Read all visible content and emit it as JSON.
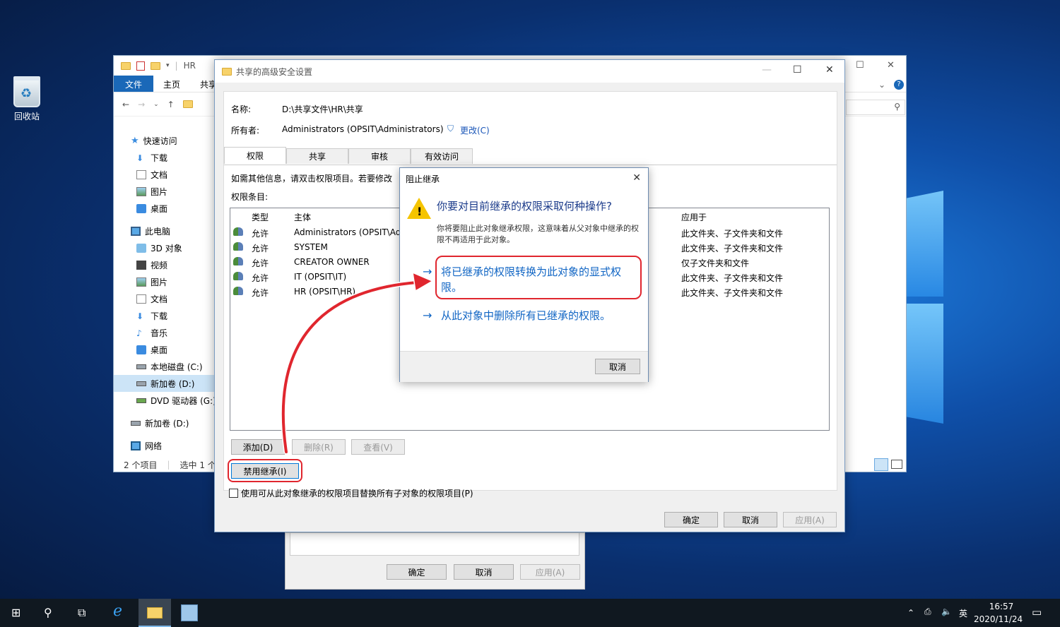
{
  "desktop": {
    "recycle_bin_label": "回收站"
  },
  "explorer": {
    "title": "HR",
    "ribbon_tabs": [
      "文件",
      "主页",
      "共享"
    ],
    "nav": {
      "quick_access": "快速访问",
      "downloads": "下载",
      "documents": "文档",
      "pictures": "图片",
      "desktop": "桌面",
      "this_pc": "此电脑",
      "objects_3d": "3D 对象",
      "videos": "视频",
      "pictures2": "图片",
      "documents2": "文档",
      "downloads2": "下载",
      "music": "音乐",
      "desktop2": "桌面",
      "local_disk": "本地磁盘 (C:)",
      "new_volume": "新加卷 (D:)",
      "dvd": "DVD 驱动器 (G:)",
      "new_volume2": "新加卷 (D:)",
      "network": "网络"
    },
    "status": {
      "items": "2 个项目",
      "selected": "选中 1 个项"
    }
  },
  "adv": {
    "title": "共享的高级安全设置",
    "name_label": "名称:",
    "name_value": "D:\\共享文件\\HR\\共享",
    "owner_label": "所有者:",
    "owner_value": "Administrators (OPSIT\\Administrators)",
    "change_link": "更改(C)",
    "tabs": [
      "权限",
      "共享",
      "审核",
      "有效访问"
    ],
    "info_text": "如需其他信息，请双击权限项目。若要修改",
    "entries_label": "权限条目:",
    "columns": {
      "type": "类型",
      "principal": "主体",
      "applies": "应用于"
    },
    "rows": [
      {
        "type": "允许",
        "principal": "Administrators (OPSIT\\Adi",
        "applies": "此文件夹、子文件夹和文件"
      },
      {
        "type": "允许",
        "principal": "SYSTEM",
        "applies": "此文件夹、子文件夹和文件"
      },
      {
        "type": "允许",
        "principal": "CREATOR OWNER",
        "applies": "仅子文件夹和文件"
      },
      {
        "type": "允许",
        "principal": "IT (OPSIT\\IT)",
        "applies": "此文件夹、子文件夹和文件"
      },
      {
        "type": "允许",
        "principal": "HR (OPSIT\\HR)",
        "applies": "此文件夹、子文件夹和文件"
      }
    ],
    "add_btn": "添加(D)",
    "remove_btn": "删除(R)",
    "view_btn": "查看(V)",
    "disable_inherit_btn": "禁用继承(I)",
    "replace_checkbox": "使用可从此对象继承的权限项目替换所有子对象的权限项目(P)",
    "ok_btn": "确定",
    "cancel_btn": "取消",
    "apply_btn": "应用(A)"
  },
  "behind": {
    "ok_btn": "确定",
    "cancel_btn": "取消",
    "apply_btn": "应用(A)"
  },
  "block": {
    "title": "阻止继承",
    "heading": "你要对目前继承的权限采取何种操作?",
    "desc": "你将要阻止此对象继承权限，这意味着从父对象中继承的权限不再适用于此对象。",
    "option1": "将已继承的权限转换为此对象的显式权限。",
    "option2": "从此对象中删除所有已继承的权限。",
    "cancel_btn": "取消"
  },
  "taskbar": {
    "time": "16:57",
    "date": "2020/11/24",
    "ime": "英"
  },
  "colors": {
    "accent": "#1065c4",
    "highlight_ring": "#e0262e",
    "warning": "#f5c400"
  }
}
